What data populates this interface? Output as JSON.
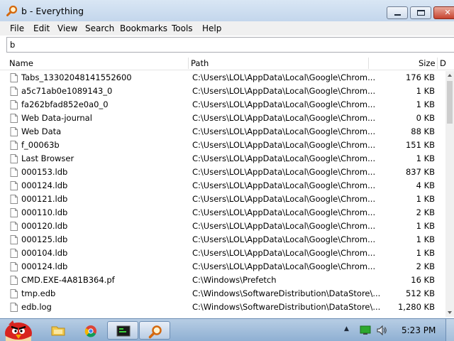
{
  "window": {
    "title": "b - Everything"
  },
  "menu": [
    "File",
    "Edit",
    "View",
    "Search",
    "Bookmarks",
    "Tools",
    "Help"
  ],
  "search": {
    "value": "b"
  },
  "columns": {
    "name": "Name",
    "path": "Path",
    "size": "Size",
    "date": "D"
  },
  "files": [
    {
      "name": "Tabs_13302048141552600",
      "path": "C:\\Users\\LOL\\AppData\\Local\\Google\\Chrom...",
      "size": "176 KB"
    },
    {
      "name": "a5c71ab0e1089143_0",
      "path": "C:\\Users\\LOL\\AppData\\Local\\Google\\Chrom...",
      "size": "1 KB"
    },
    {
      "name": "fa262bfad852e0a0_0",
      "path": "C:\\Users\\LOL\\AppData\\Local\\Google\\Chrom...",
      "size": "1 KB"
    },
    {
      "name": "Web Data-journal",
      "path": "C:\\Users\\LOL\\AppData\\Local\\Google\\Chrom...",
      "size": "0 KB"
    },
    {
      "name": "Web Data",
      "path": "C:\\Users\\LOL\\AppData\\Local\\Google\\Chrom...",
      "size": "88 KB"
    },
    {
      "name": "f_00063b",
      "path": "C:\\Users\\LOL\\AppData\\Local\\Google\\Chrom...",
      "size": "151 KB"
    },
    {
      "name": "Last Browser",
      "path": "C:\\Users\\LOL\\AppData\\Local\\Google\\Chrom...",
      "size": "1 KB"
    },
    {
      "name": "000153.ldb",
      "path": "C:\\Users\\LOL\\AppData\\Local\\Google\\Chrom...",
      "size": "837 KB"
    },
    {
      "name": "000124.ldb",
      "path": "C:\\Users\\LOL\\AppData\\Local\\Google\\Chrom...",
      "size": "4 KB"
    },
    {
      "name": "000121.ldb",
      "path": "C:\\Users\\LOL\\AppData\\Local\\Google\\Chrom...",
      "size": "1 KB"
    },
    {
      "name": "000110.ldb",
      "path": "C:\\Users\\LOL\\AppData\\Local\\Google\\Chrom...",
      "size": "2 KB"
    },
    {
      "name": "000120.ldb",
      "path": "C:\\Users\\LOL\\AppData\\Local\\Google\\Chrom...",
      "size": "1 KB"
    },
    {
      "name": "000125.ldb",
      "path": "C:\\Users\\LOL\\AppData\\Local\\Google\\Chrom...",
      "size": "1 KB"
    },
    {
      "name": "000104.ldb",
      "path": "C:\\Users\\LOL\\AppData\\Local\\Google\\Chrom...",
      "size": "1 KB"
    },
    {
      "name": "000124.ldb",
      "path": "C:\\Users\\LOL\\AppData\\Local\\Google\\Chrom...",
      "size": "2 KB"
    },
    {
      "name": "CMD.EXE-4A81B364.pf",
      "path": "C:\\Windows\\Prefetch",
      "size": "16 KB"
    },
    {
      "name": "tmp.edb",
      "path": "C:\\Windows\\SoftwareDistribution\\DataStore\\...",
      "size": "512 KB"
    },
    {
      "name": "edb.log",
      "path": "C:\\Windows\\SoftwareDistribution\\DataStore\\...",
      "size": "1,280 KB"
    }
  ],
  "taskbar": {
    "clock": "5:23 PM"
  },
  "colors": {
    "title_gradient_top": "#d9e6f4",
    "title_gradient_bottom": "#c3d6ec",
    "close_button": "#c7432e",
    "menu_bg": "#f0f0f0",
    "taskbar": "#a9c2de"
  }
}
